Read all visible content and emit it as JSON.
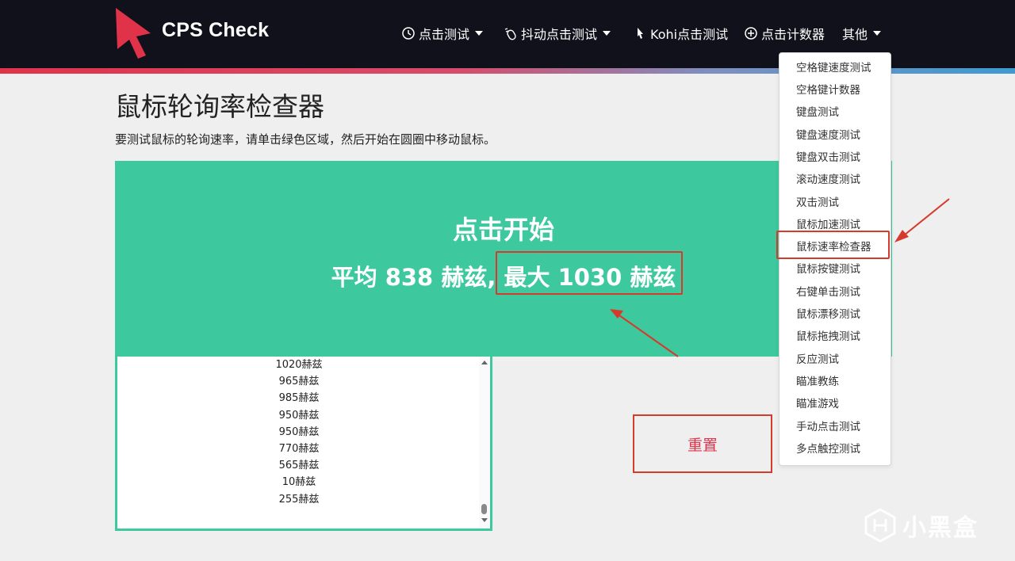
{
  "header": {
    "brand": "CPS Check",
    "nav": [
      {
        "label": "点击测试",
        "icon": "clock-icon",
        "has_caret": true
      },
      {
        "label": "抖动点击测试",
        "icon": "mouse-icon",
        "has_caret": true
      },
      {
        "label": "Kohi点击测试",
        "icon": "cursor-icon",
        "has_caret": false
      },
      {
        "label": "点击计数器",
        "icon": "plus-circle-icon",
        "has_caret": false
      },
      {
        "label": "其他",
        "icon": "",
        "has_caret": true
      }
    ]
  },
  "main": {
    "title": "鼠标轮询率检查器",
    "instruction": "要测试鼠标的轮询速率，请单击绿色区域，然后开始在圆圈中移动鼠标。",
    "start_text": "点击开始",
    "avg_text": "平均 838 赫兹,",
    "max_text": "最大 1030 赫兹",
    "log": [
      "1020赫兹",
      "965赫兹",
      "985赫兹",
      "950赫兹",
      "950赫兹",
      "770赫兹",
      "565赫兹",
      "10赫兹",
      "255赫兹"
    ],
    "reset_label": "重置"
  },
  "dropdown": {
    "items": [
      "空格键速度测试",
      "空格键计数器",
      "键盘测试",
      "键盘速度测试",
      "键盘双击测试",
      "滚动速度测试",
      "双击测试",
      "鼠标加速测试",
      "鼠标速率检查器",
      "鼠标按键测试",
      "右键单击测试",
      "鼠标漂移测试",
      "鼠标拖拽测试",
      "反应测试",
      "瞄准教练",
      "瞄准游戏",
      "手动点击测试",
      "多点触控测试"
    ],
    "highlighted_index": 8
  },
  "watermark": {
    "text": "小黑盒"
  },
  "colors": {
    "navbar": "#11111b",
    "accent_red": "#e0334a",
    "green_area": "#3ec89e",
    "annotation_red": "#d63a2c"
  }
}
